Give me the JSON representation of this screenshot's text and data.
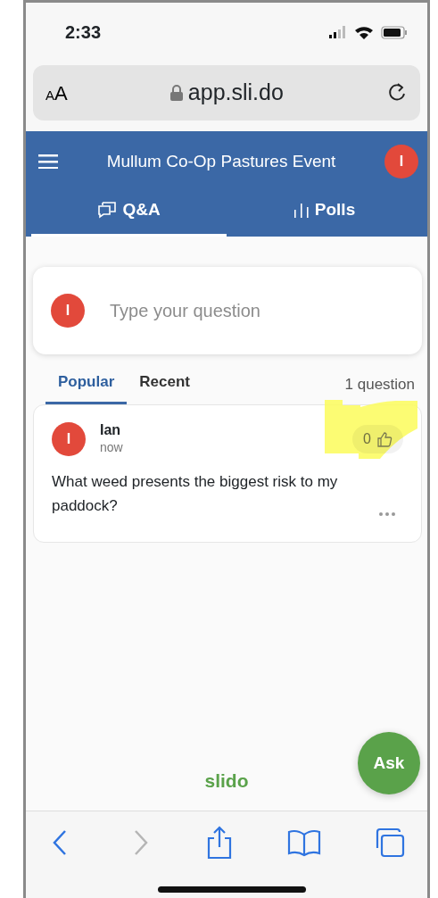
{
  "status_bar": {
    "time": "2:33"
  },
  "browser": {
    "text_size": "AA",
    "url": "app.sli.do"
  },
  "header": {
    "title": "Mullum Co-Op Pastures Event",
    "avatar": "I"
  },
  "tabs": [
    {
      "kind": "qa",
      "label": "Q&A",
      "selected": true
    },
    {
      "kind": "polls",
      "label": "Polls",
      "selected": false
    }
  ],
  "question_input": {
    "avatar": "I",
    "placeholder": "Type your question"
  },
  "sort_tabs": [
    {
      "label": "Popular",
      "selected": true
    },
    {
      "label": "Recent",
      "selected": false
    }
  ],
  "question_count": "1 question",
  "questions": [
    {
      "avatar": "I",
      "author": "Ian",
      "time": "now",
      "likes": "0",
      "text": "What weed presents the biggest risk to my paddock?"
    }
  ],
  "brand": "slido",
  "ask_button": "Ask",
  "toolbar": [
    {
      "kind": "back",
      "disabled": false
    },
    {
      "kind": "forward",
      "disabled": true
    },
    {
      "kind": "share",
      "disabled": false
    },
    {
      "kind": "bookmarks",
      "disabled": false
    },
    {
      "kind": "tabs",
      "disabled": false
    }
  ]
}
